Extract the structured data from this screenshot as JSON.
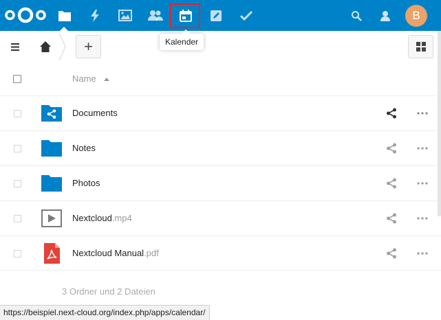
{
  "header": {
    "apps": [
      {
        "name": "files",
        "icon": "folder-icon"
      },
      {
        "name": "activity",
        "icon": "lightning-icon"
      },
      {
        "name": "gallery",
        "icon": "image-icon"
      },
      {
        "name": "contacts",
        "icon": "contacts-icon"
      },
      {
        "name": "calendar",
        "icon": "calendar-icon"
      },
      {
        "name": "notes",
        "icon": "pencil-icon"
      },
      {
        "name": "tasks",
        "icon": "checkmark-icon"
      }
    ],
    "avatar_initial": "B",
    "background": "#0082c9"
  },
  "tooltip": {
    "label": "Kalender"
  },
  "controls": {
    "add_label": "+"
  },
  "table": {
    "header": {
      "name_label": "Name"
    },
    "rows": [
      {
        "base": "Documents",
        "ext": "",
        "type": "shared-folder"
      },
      {
        "base": "Notes",
        "ext": "",
        "type": "folder"
      },
      {
        "base": "Photos",
        "ext": "",
        "type": "folder"
      },
      {
        "base": "Nextcloud",
        "ext": ".mp4",
        "type": "video"
      },
      {
        "base": "Nextcloud Manual",
        "ext": ".pdf",
        "type": "pdf"
      }
    ],
    "summary": "3 Ordner und 2 Dateien"
  },
  "statusbar": {
    "url": "https://beispiel.next-cloud.org/index.php/apps/calendar/"
  }
}
